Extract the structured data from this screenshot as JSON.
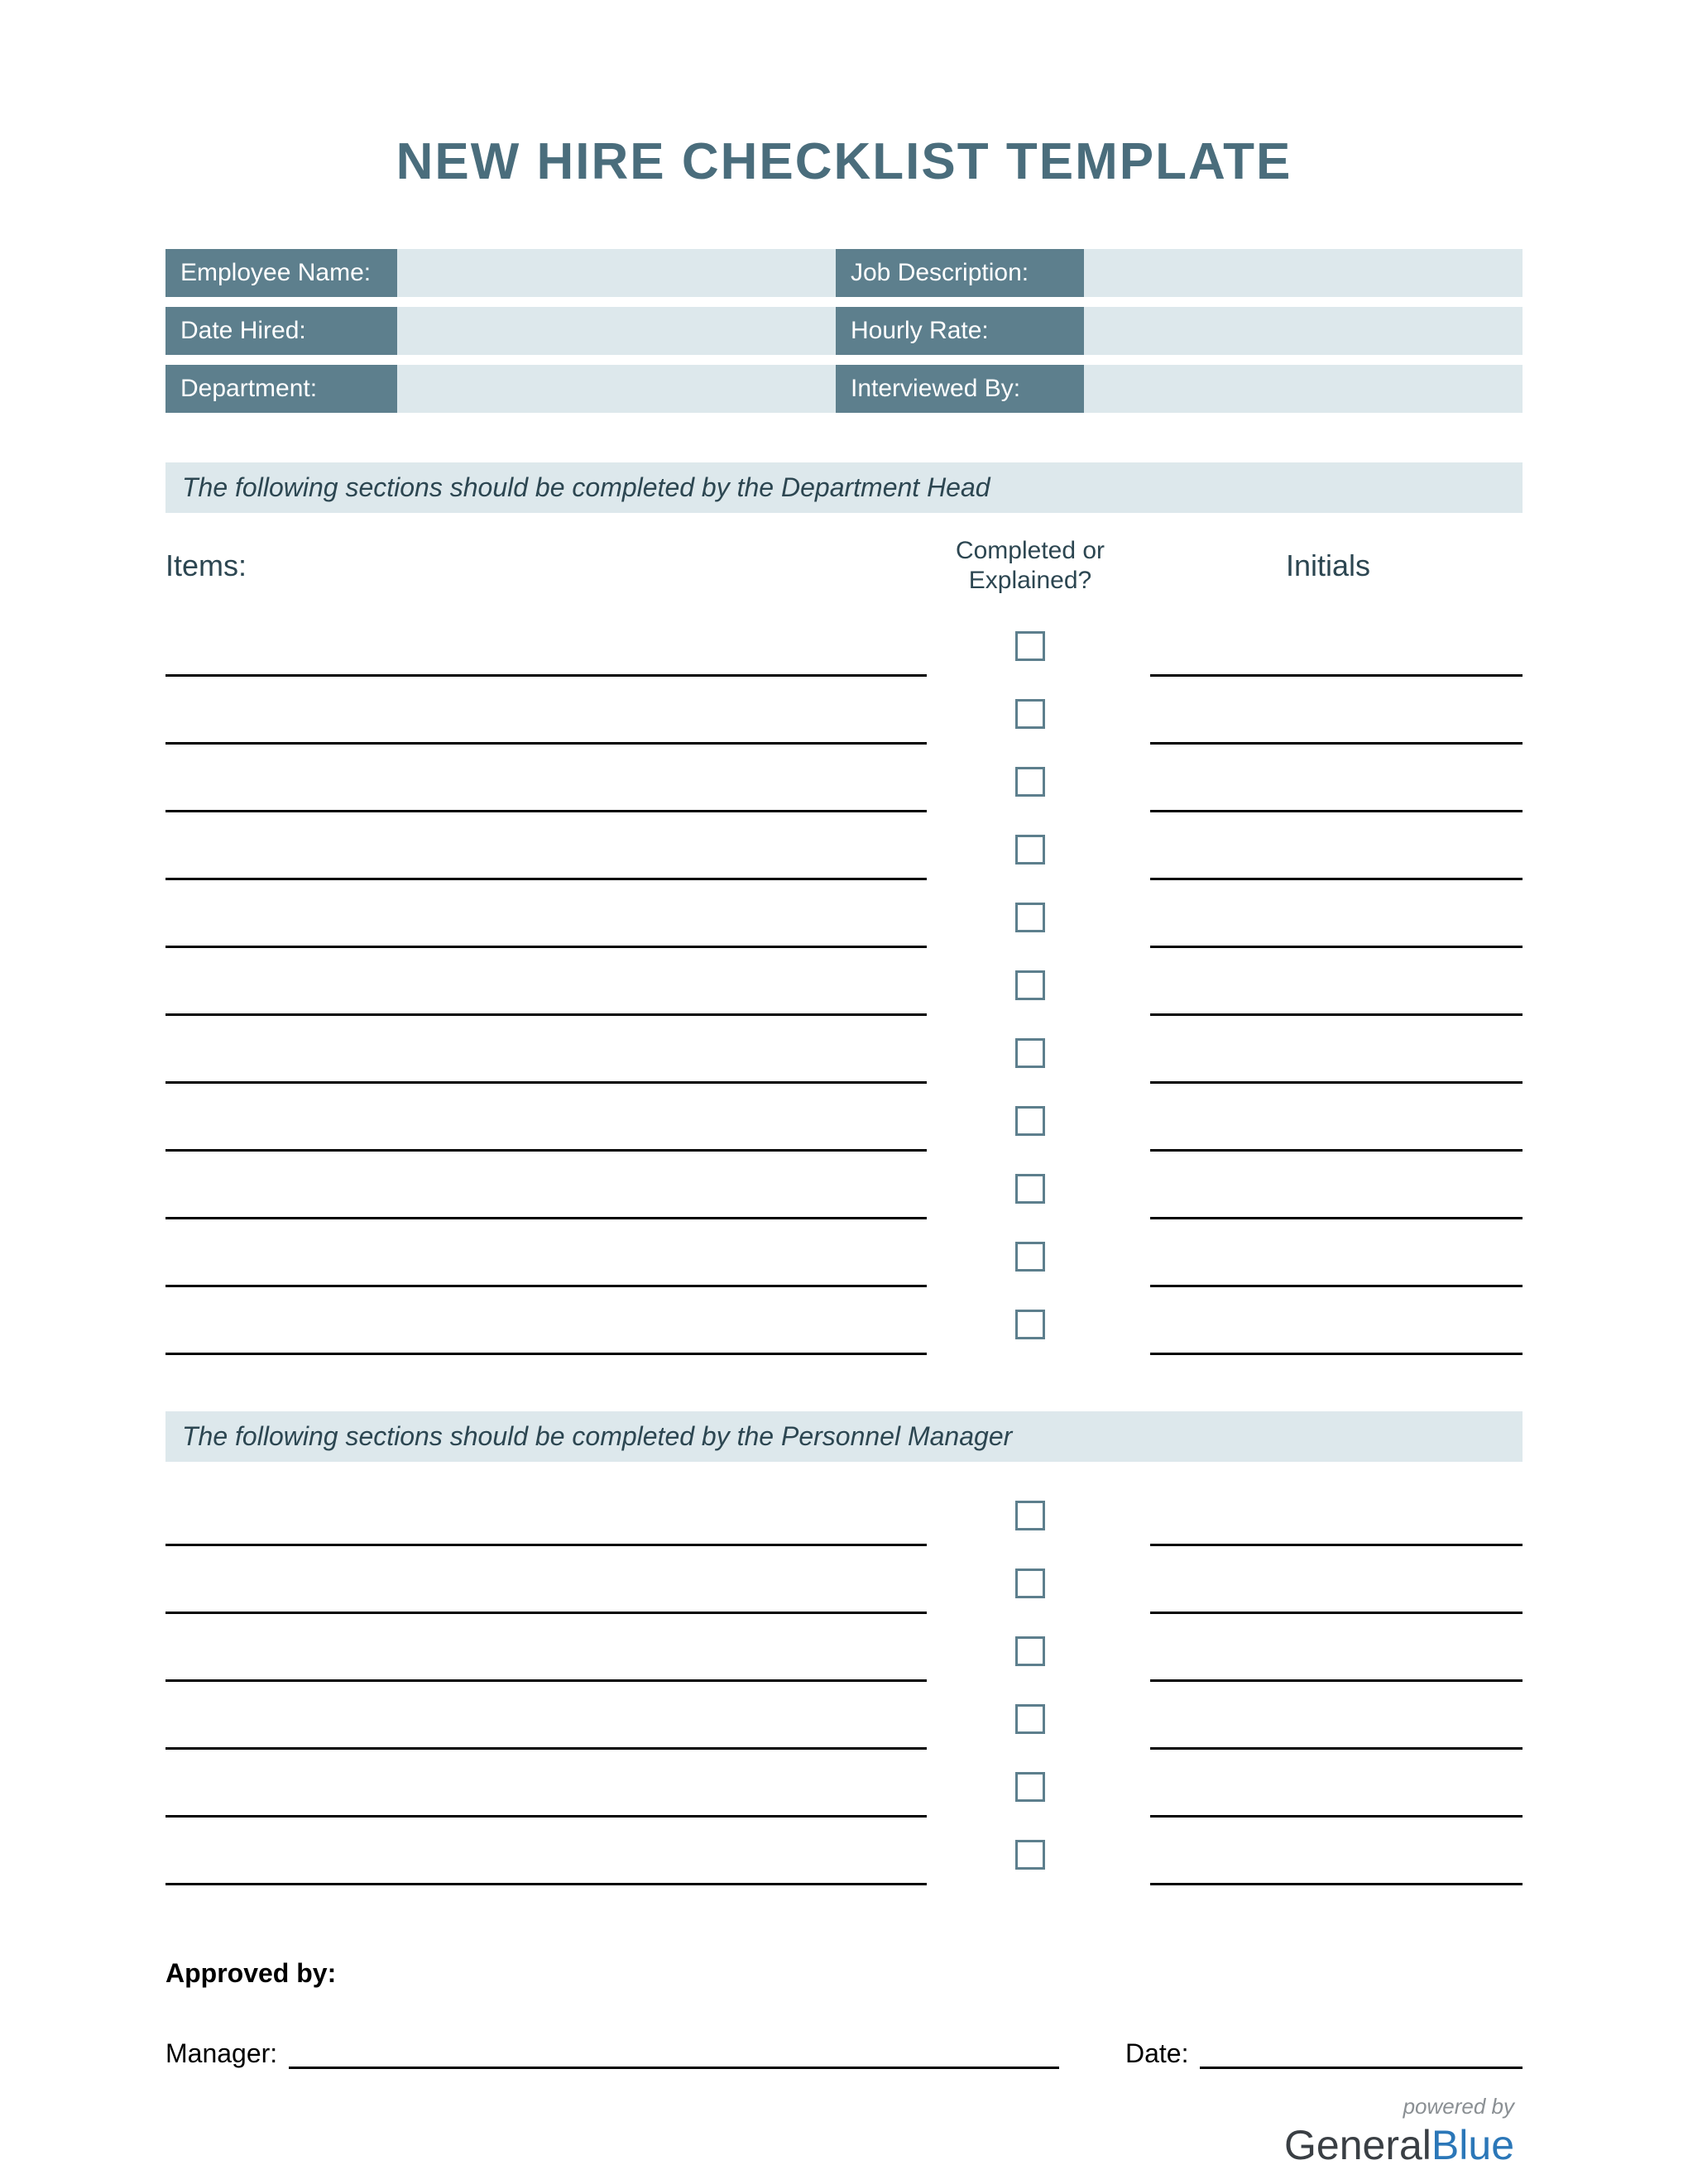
{
  "title": "NEW HIRE CHECKLIST TEMPLATE",
  "info": {
    "employee_name_label": "Employee Name:",
    "employee_name_value": "",
    "job_description_label": "Job Description:",
    "job_description_value": "",
    "date_hired_label": "Date Hired:",
    "date_hired_value": "",
    "hourly_rate_label": "Hourly Rate:",
    "hourly_rate_value": "",
    "department_label": "Department:",
    "department_value": "",
    "interviewed_by_label": "Interviewed By:",
    "interviewed_by_value": ""
  },
  "section1_banner": "The following sections should be completed by the Department Head",
  "headers": {
    "items": "Items:",
    "completed": "Completed or Explained?",
    "initials": "Initials"
  },
  "section1_rows": 11,
  "section2_banner": "The following sections should be completed by the Personnel Manager",
  "section2_rows": 6,
  "approve": {
    "approved_by": "Approved by:",
    "manager": "Manager:",
    "date": "Date:"
  },
  "footer": {
    "powered": "powered by",
    "brand1": "General",
    "brand2": "Blue"
  }
}
